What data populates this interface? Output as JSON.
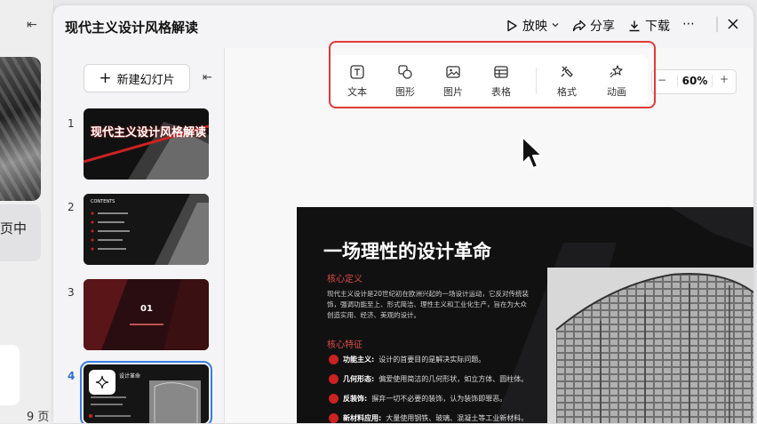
{
  "left_panel": {
    "text": "页中",
    "bottom_text": "9 页"
  },
  "header": {
    "title": "现代主义设计风格解读",
    "play_label": "放映",
    "share_label": "分享",
    "download_label": "下载"
  },
  "sidebar": {
    "new_slide_label": "新建幻灯片",
    "slides": [
      {
        "number": "1",
        "title": "现代主义设计风格解读"
      },
      {
        "number": "2",
        "title": "CONTENTS"
      },
      {
        "number": "3",
        "title": "01"
      },
      {
        "number": "4",
        "title": "设计革命"
      }
    ]
  },
  "toolbar": {
    "tools": [
      {
        "label": "文本",
        "icon": "text-icon"
      },
      {
        "label": "图形",
        "icon": "shape-icon"
      },
      {
        "label": "图片",
        "icon": "image-icon"
      },
      {
        "label": "表格",
        "icon": "table-icon"
      },
      {
        "label": "格式",
        "icon": "format-painter-icon"
      },
      {
        "label": "动画",
        "icon": "animation-icon"
      }
    ]
  },
  "zoom": {
    "value": "60%",
    "minus": "−",
    "plus": "+"
  },
  "slide": {
    "title": "一场理性的设计革命",
    "section1": "核心定义",
    "definition": "现代主义设计是20世纪初在欧洲兴起的一场设计运动，它反对传统装饰，强调功能至上、形式简洁、理性主义和工业化生产，旨在为大众创造实用、经济、美观的设计。",
    "section2": "核心特征",
    "features": [
      {
        "label": "功能主义:",
        "text": "设计的首要目的是解决实际问题。"
      },
      {
        "label": "几何形态:",
        "text": "偏爱使用简洁的几何形状，如立方体、圆柱体。"
      },
      {
        "label": "反装饰:",
        "text": "摒弃一切不必要的装饰，认为装饰即罪恶。"
      },
      {
        "label": "新材料应用:",
        "text": "大量使用钢铁、玻璃、混凝土等工业新材料。"
      }
    ]
  },
  "colors": {
    "accent": "#e03a3a",
    "slide_bg": "#111111",
    "slide_red": "#c22222"
  }
}
